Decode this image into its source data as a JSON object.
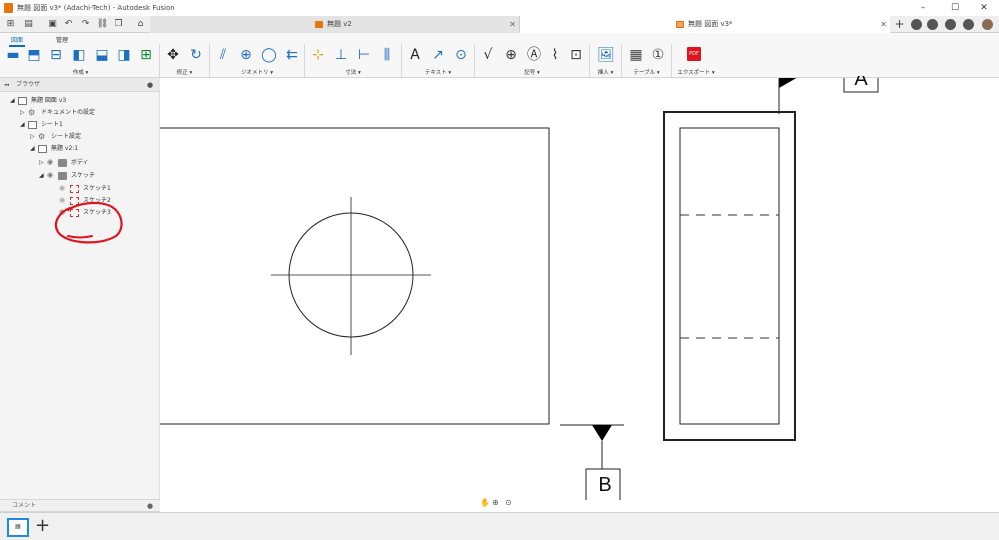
{
  "window": {
    "title": "無題 図面 v3* (Adachi-Tech) - Autodesk Fusion",
    "controls": [
      "–",
      "☐",
      "✕"
    ]
  },
  "tabs": [
    {
      "label": "無題 v2",
      "active": false
    },
    {
      "label": "無題 図面 v3*",
      "active": true
    }
  ],
  "ribbon": {
    "tabs": [
      {
        "label": "図面",
        "active": true
      },
      {
        "label": "管理",
        "active": false
      }
    ],
    "groups": [
      {
        "label": "作成 ▾"
      },
      {
        "label": "修正 ▾"
      },
      {
        "label": "ジオメトリ ▾"
      },
      {
        "label": "寸法 ▾"
      },
      {
        "label": "テキスト ▾"
      },
      {
        "label": "記号 ▾"
      },
      {
        "label": "挿入 ▾"
      },
      {
        "label": "テーブル ▾"
      },
      {
        "label": "エクスポート ▾"
      }
    ],
    "pdf_label": "PDF"
  },
  "browser": {
    "header": "ブラウザ",
    "nodes": [
      {
        "label": "無題 図面 v3"
      },
      {
        "label": "ドキュメントの設定"
      },
      {
        "label": "シート1"
      },
      {
        "label": "シート設定"
      },
      {
        "label": "無題 v2:1"
      },
      {
        "label": "ボディ"
      },
      {
        "label": "スケッチ"
      },
      {
        "label": "スケッチ1"
      },
      {
        "label": "スケッチ2"
      },
      {
        "label": "スケッチ3"
      }
    ]
  },
  "comments": {
    "label": "コメント"
  },
  "drawing": {
    "label_a": "A",
    "label_b": "B"
  },
  "colors": {
    "accent": "#0a6cc2",
    "annotation": "#e0141e",
    "logo": "#e8740c"
  }
}
